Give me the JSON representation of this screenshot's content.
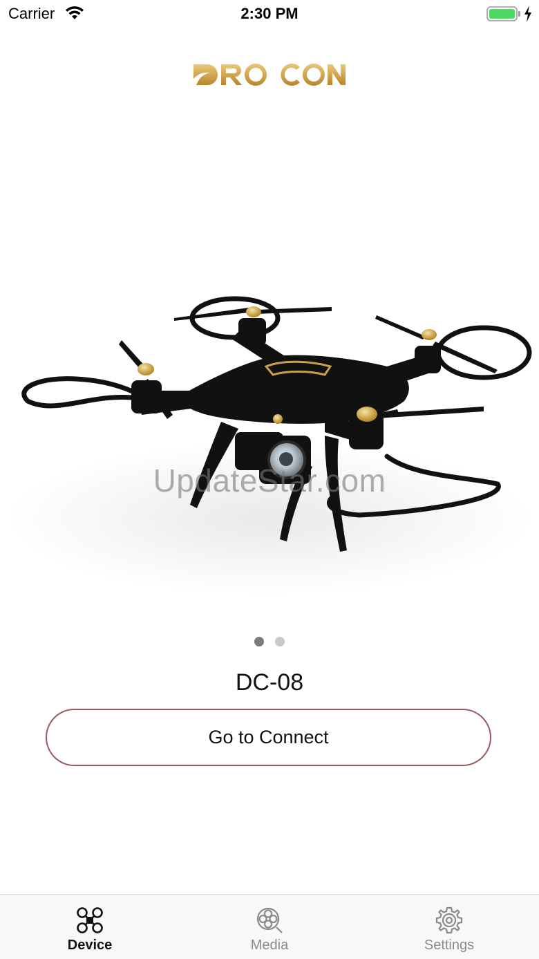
{
  "status_bar": {
    "carrier": "Carrier",
    "time": "2:30 PM",
    "battery_color": "#4cd964"
  },
  "header": {
    "logo_text": "DROCON",
    "logo_color": "#c9a14a"
  },
  "carousel": {
    "watermark": "UpdateStar.com",
    "page_count": 2,
    "active_page": 1
  },
  "device": {
    "name": "DC-08",
    "connect_label": "Go to Connect",
    "button_border_color": "#9a5a5e"
  },
  "tab_bar": {
    "items": [
      {
        "label": "Device",
        "icon": "drone-icon",
        "active": true
      },
      {
        "label": "Media",
        "icon": "media-icon",
        "active": false
      },
      {
        "label": "Settings",
        "icon": "gear-icon",
        "active": false
      }
    ]
  }
}
